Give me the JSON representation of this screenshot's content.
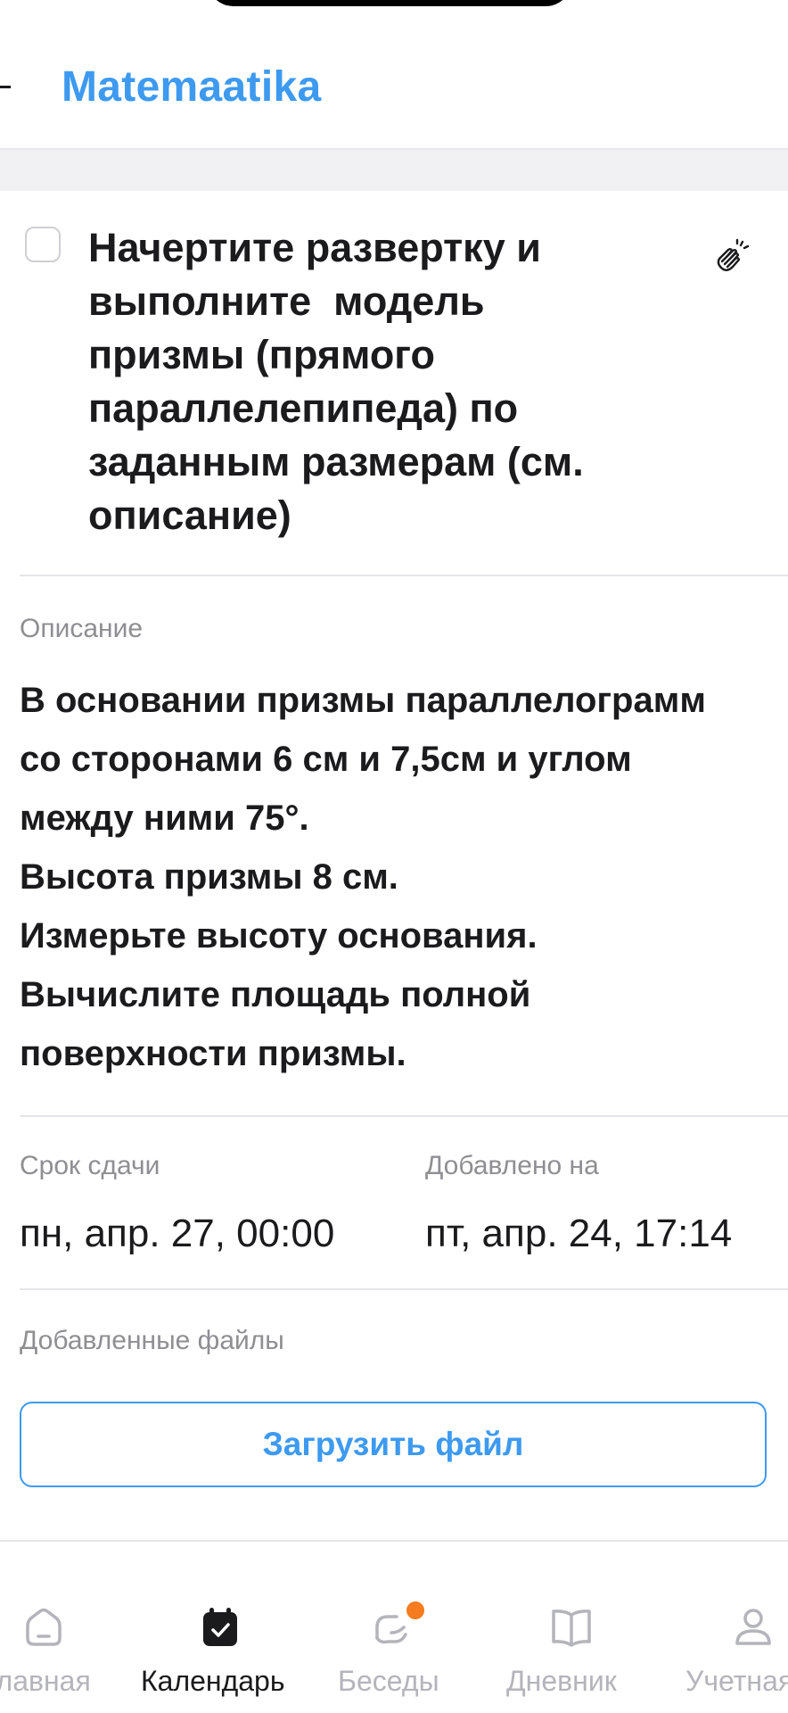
{
  "header": {
    "title": "Matemaatika"
  },
  "task": {
    "title": "Начертите развертку и\nвыполните  модель\nпризмы (прямого\nпараллелепипеда) по\nзаданным размерам (см.\nописание)",
    "checked": false
  },
  "description": {
    "label": "Описание",
    "text": "В основании призмы параллелограмм\nсо сторонами 6 см и 7,5см и углом\nмежду ними 75°.\nВысота призмы 8 см.\nИзмерьте высоту основания.\nВычислите площадь полной\nповерхности призмы."
  },
  "dates": {
    "due_label": "Срок сдачи",
    "due_value": "пн, апр. 27, 00:00",
    "added_label": "Добавлено на",
    "added_value": "пт, апр. 24, 17:14"
  },
  "files": {
    "label": "Добавленные файлы",
    "upload_label": "Загрузить файл"
  },
  "tabbar": {
    "items": [
      {
        "label": "Главная",
        "icon": "home-icon",
        "active": false
      },
      {
        "label": "Календарь",
        "icon": "calendar-icon",
        "active": true
      },
      {
        "label": "Беседы",
        "icon": "chat-icon",
        "active": false,
        "badge": true
      },
      {
        "label": "Дневник",
        "icon": "book-icon",
        "active": false
      },
      {
        "label": "Учетная",
        "icon": "user-icon",
        "active": false
      }
    ]
  },
  "colors": {
    "accent": "#3d9af0",
    "badge": "#f57c1f",
    "text": "#1b1b1d",
    "muted": "#8e8e93"
  }
}
